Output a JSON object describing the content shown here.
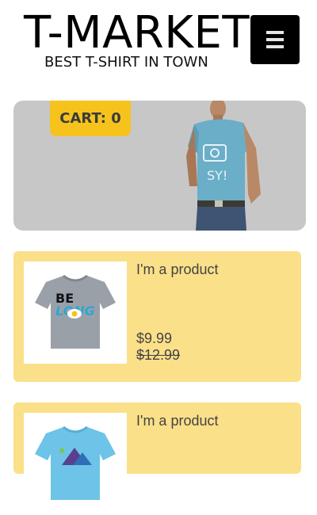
{
  "header": {
    "title": "T-MARKET",
    "tagline": "BEST T-SHIRT IN TOWN",
    "menu_icon": "hamburger-menu-icon"
  },
  "hero": {
    "cart_label": "CART: 0",
    "background_color": "#c7c7c7"
  },
  "products": [
    {
      "name": "I'm a product",
      "price": "$9.99",
      "original_price": "$12.99"
    },
    {
      "name": "I'm a product"
    }
  ],
  "colors": {
    "card_background": "#fbe08a",
    "cart_accent": "#f6c31c"
  }
}
